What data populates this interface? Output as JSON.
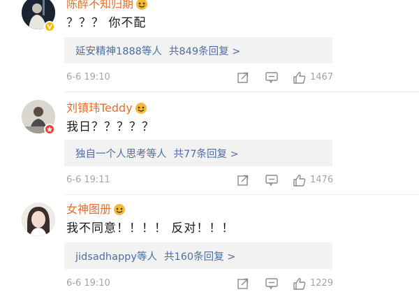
{
  "comments": [
    {
      "username": "陈醉不知归期",
      "text": "？？？ 你不配",
      "replies": {
        "who": "延安精神1888等人",
        "count": "共849条回复 >"
      },
      "time": "6-6 19:10",
      "likes": "1467",
      "verified_color": "#f5b800"
    },
    {
      "username": "刘镇玮Teddy",
      "text": "我日？？？？？",
      "replies": {
        "who": "独自一个人思考等人",
        "count": "共77条回复 >"
      },
      "time": "6-6 19:11",
      "likes": "1476",
      "verified_color": "#e8412f"
    },
    {
      "username": "女神图册",
      "text": "我不同意！！！！ 反对！！！",
      "replies": {
        "who": "jidsadhappy等人",
        "count": "共160条回复 >"
      },
      "time": "6-6 19:10",
      "likes": "1229"
    }
  ],
  "colors": {
    "username": "#e86c2c",
    "link": "#4e6ea0",
    "meta": "#a4a4a4",
    "reply_bg": "#f2f2f2"
  },
  "icons": [
    "share-icon",
    "comment-icon",
    "like-icon",
    "verified-badge-icon",
    "emoji-badge-icon"
  ]
}
